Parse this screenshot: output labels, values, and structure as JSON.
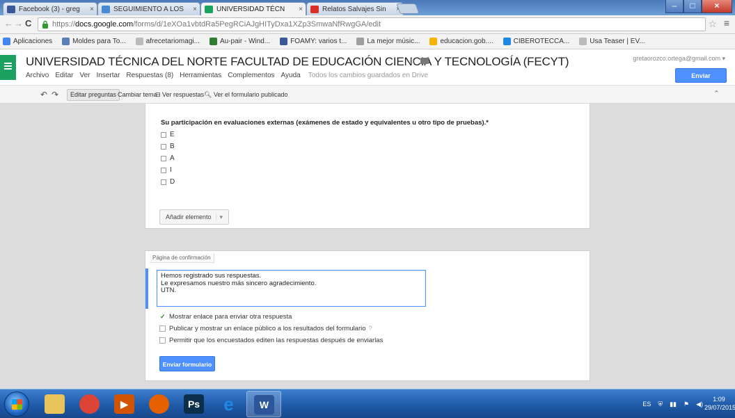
{
  "browser": {
    "tabs": [
      {
        "label": "Facebook (3) - greg",
        "color": "#3b5998"
      },
      {
        "label": "SEGUIMIENTO A LOS",
        "color": "#4a8ad4"
      },
      {
        "label": "UNIVERSIDAD TÉCN",
        "color": "#1ba261"
      },
      {
        "label": "Relatos Salvajes Sin",
        "color": "#d93025"
      }
    ],
    "url_prefix": "https://",
    "url_host": "docs.google.com",
    "url_path": "/forms/d/1eXOa1vbtdRa5PegRCiAJgHITyDxa1XZp3SmwaNfRwgGA/edit",
    "menu_glyph": "≡",
    "star_glyph": "☆"
  },
  "bookmarks": [
    {
      "label": "Aplicaciones",
      "icon": "apps-icon",
      "color": "#4285f4"
    },
    {
      "label": "Moldes para To...",
      "icon": "bookmark-icon",
      "color": "#5b7fb8"
    },
    {
      "label": "afrecetariomagi...",
      "icon": "page-icon",
      "color": "#bbbbbb"
    },
    {
      "label": "Au-pair - Wind...",
      "icon": "au-pair-icon",
      "color": "#2e7d32"
    },
    {
      "label": "FOAMY: varios t...",
      "icon": "foamy-icon",
      "color": "#3b5998"
    },
    {
      "label": "La mejor músic...",
      "icon": "music-icon",
      "color": "#9e9e9e"
    },
    {
      "label": "educacion.gob....",
      "icon": "gov-icon",
      "color": "#f5b400"
    },
    {
      "label": "CIBEROTECCA...",
      "icon": "ciberotecca-icon",
      "color": "#1e88e5"
    },
    {
      "label": "Usa Teaser | EV...",
      "icon": "page-icon",
      "color": "#bbbbbb"
    }
  ],
  "docs": {
    "title": "UNIVERSIDAD TÉCNICA DEL NORTE FACULTAD DE EDUCACIÓN CIENCIA Y TECNOLOGÍA (FECYT)",
    "menu": [
      "Archivo",
      "Editar",
      "Ver",
      "Insertar",
      "Respuestas (8)",
      "Herramientas",
      "Complementos",
      "Ayuda"
    ],
    "saved_status": "Todos los cambios guardados en Drive",
    "account": "gretaorozco.ortega@gmail.com ▾",
    "send_button": "Enviar formulario"
  },
  "form_toolbar": {
    "edit_questions": "Editar preguntas",
    "change_theme": "Cambiar tema",
    "view_responses": "Ver respuestas",
    "view_published": "Ver el formulario publicado"
  },
  "question": {
    "title": "Su participación en evaluaciones externas (exámenes de estado y equivalentes u otro tipo de pruebas).*",
    "options": [
      "E",
      "B",
      "A",
      "I",
      "D"
    ],
    "add_item": "Añadir elemento",
    "add_item_arrow": "▾"
  },
  "confirmation": {
    "label": "Página de confirmación",
    "message": "Hemos registrado sus respuestas.\nLe expresamos nuestro más sincero agradecimiento.\nUTN.",
    "options": [
      {
        "label": "Mostrar enlace para enviar otra respuesta",
        "checked": true
      },
      {
        "label": "Publicar y mostrar un enlace público a los resultados del formulario",
        "checked": false
      },
      {
        "label": "Permitir que los encuestados editen las respuestas después de enviarlas",
        "checked": false
      }
    ],
    "send_button": "Enviar formulario"
  },
  "taskbar": {
    "apps": [
      {
        "name": "explorer",
        "glyph": "",
        "color": "#e8c35a"
      },
      {
        "name": "chrome",
        "glyph": "",
        "color": "#db4437"
      },
      {
        "name": "media-player",
        "glyph": "▶",
        "color": "#d35400"
      },
      {
        "name": "firefox",
        "glyph": "",
        "color": "#e66000"
      },
      {
        "name": "photoshop",
        "glyph": "Ps",
        "color": "#0c2f4d"
      },
      {
        "name": "internet-explorer",
        "glyph": "e",
        "color": "#1e88e5"
      },
      {
        "name": "word",
        "glyph": "W",
        "color": "#2b579a"
      }
    ],
    "language": "ES",
    "time": "1:09",
    "date": "29/07/2015"
  }
}
